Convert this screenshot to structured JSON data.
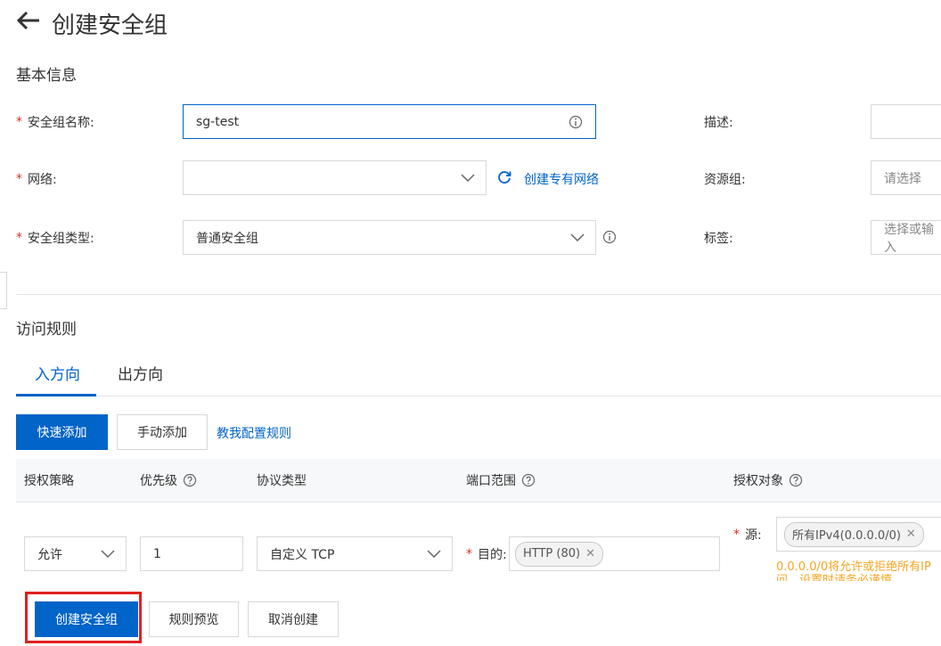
{
  "header": {
    "back_icon": "arrow-left-icon",
    "title": "创建安全组"
  },
  "basic": {
    "section_title": "基本信息",
    "name_label": "安全组名称:",
    "name_value": "sg-test",
    "network_label": "网络:",
    "network_value": "",
    "create_vpc_link": "创建专有网络",
    "type_label": "安全组类型:",
    "type_value": "普通安全组",
    "desc_label": "描述:",
    "desc_value": "",
    "resource_group_label": "资源组:",
    "resource_group_placeholder": "请选择",
    "tag_label": "标签:",
    "tag_placeholder": "选择或输入"
  },
  "rules": {
    "section_title": "访问规则",
    "tabs": [
      {
        "label": "入方向",
        "active": true
      },
      {
        "label": "出方向",
        "active": false
      }
    ],
    "quick_add": "快速添加",
    "manual_add": "手动添加",
    "help_link": "教我配置规则",
    "columns": {
      "policy": "授权策略",
      "priority": "优先级",
      "protocol": "协议类型",
      "port_range": "端口范围",
      "auth_object": "授权对象"
    },
    "row": {
      "policy": "允许",
      "priority": "1",
      "protocol": "自定义 TCP",
      "dest_label": "目的:",
      "dest_tag": "HTTP (80)",
      "source_label": "源:",
      "source_tag": "所有IPv4(0.0.0.0/0)",
      "warning_line1": "0.0.0.0/0将允许或拒绝所有IP",
      "warning_line2": "问，设置时请务必谨慎"
    }
  },
  "footer": {
    "create": "创建安全组",
    "preview": "规则预览",
    "cancel": "取消创建"
  },
  "colors": {
    "primary": "#0064c8",
    "required": "#d93026",
    "warning": "#f6a623",
    "highlight": "#e02020"
  }
}
